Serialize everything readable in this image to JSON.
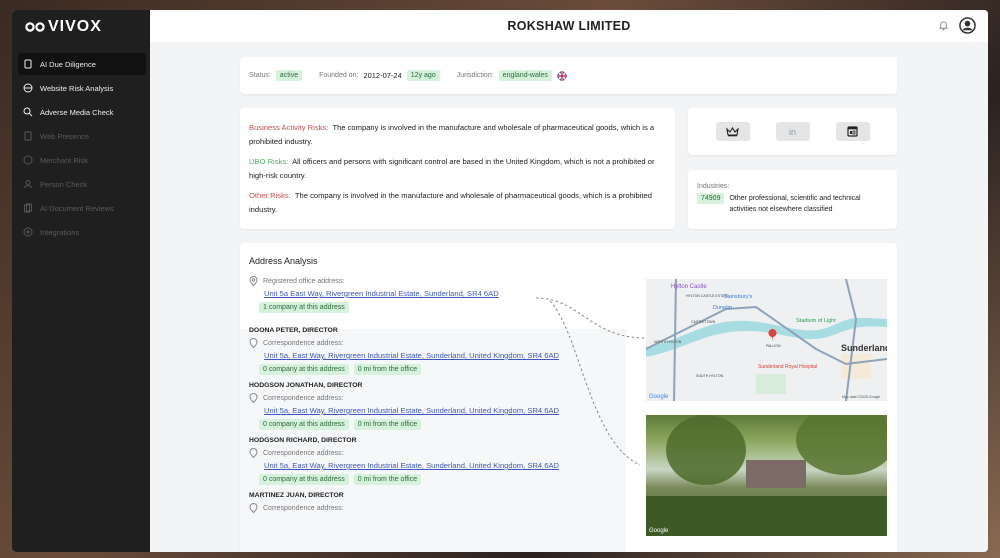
{
  "brand": "VIVOX",
  "sidebar": {
    "items": [
      {
        "label": "AI Due Diligence",
        "icon": "document-icon",
        "state": "active"
      },
      {
        "label": "Website Risk Analysis",
        "icon": "globe-icon",
        "state": "enabled"
      },
      {
        "label": "Adverse Media Check",
        "icon": "search-icon",
        "state": "enabled"
      },
      {
        "label": "Web Presence",
        "icon": "building-icon",
        "state": "disabled"
      },
      {
        "label": "Merchant Risk",
        "icon": "globe-icon",
        "state": "disabled"
      },
      {
        "label": "Person Check",
        "icon": "people-icon",
        "state": "disabled"
      },
      {
        "label": "AI Document Reviews",
        "icon": "files-icon",
        "state": "disabled"
      },
      {
        "label": "Integrations",
        "icon": "plus-circle-icon",
        "state": "disabled"
      }
    ]
  },
  "header": {
    "title": "ROKSHAW LIMITED"
  },
  "status": {
    "status_label": "Status:",
    "status": "active",
    "founded_label": "Founded on:",
    "founded": "2012-07-24",
    "age": "12y ago",
    "jurisdiction_label": "Jurisdiction:",
    "jurisdiction": "england-wales"
  },
  "risks": [
    {
      "label": "Business Activity Risks:",
      "text": "The company is involved in the manufacture and wholesale of pharmaceutical goods, which is a prohibited industry.",
      "color": "#c0504d"
    },
    {
      "label": "UBO Risks:",
      "text": "All officers and persons with significant control are based in the United Kingdom, which is not a prohibited or high-risk country.",
      "color": "#4caf63"
    },
    {
      "label": "Other Risks:",
      "text": "The company is involved in the manufacture and wholesale of pharmaceutical goods, which is a prohibited industry.",
      "color": "#c0504d"
    }
  ],
  "links": {
    "linkedin": "in"
  },
  "industries": {
    "label": "Industries:",
    "code": "74909",
    "description": "Other professional, scientific and technical activities not elsewhere classified"
  },
  "address": {
    "title": "Address Analysis",
    "registered_label": "Registered office address:",
    "registered": "Unit 5a East Way, Rivergreen Industrial Estate, Sunderland, SR4 6AD",
    "registered_tag": "1 company at this address",
    "directors": [
      {
        "name": "DOONA PETER, DIRECTOR",
        "label": "Correspondence address:",
        "address": "Unit 5a, East Way, Rivergreen Industrial Estate, Sunderland, United Kingdom, SR4 6AD",
        "count": "0 company at this address",
        "distance": "0 mi from the office"
      },
      {
        "name": "HODGSON JONATHAN, DIRECTOR",
        "label": "Correspondence address:",
        "address": "Unit 5a, East Way, Rivergreen Industrial Estate, Sunderland, United Kingdom, SR4 6AD",
        "count": "0 company at this address",
        "distance": "0 mi from the office"
      },
      {
        "name": "HODGSON RICHARD, DIRECTOR",
        "label": "Correspondence address:",
        "address": "Unit 5a, East Way, Rivergreen Industrial Estate, Sunderland, United Kingdom, SR4 6AD",
        "count": "0 company at this address",
        "distance": "0 mi from the office"
      },
      {
        "name": "MARTINEZ JUAN, DIRECTOR",
        "label": "Correspondence address:"
      }
    ]
  },
  "map": {
    "labels": [
      "Hylton Castle",
      "HYLTON CASTLE ESTATE",
      "Sainsbury's",
      "Dunelm",
      "CASTLETOWN",
      "Stadium of Light",
      "PALLION",
      "Sunderland",
      "Sunderland Royal Hospital",
      "SOUTH HYLTON",
      "NORTH HYLTON"
    ],
    "attribution": "Map data ©2025 Google",
    "google": "Google"
  },
  "photo": {
    "google": "Google"
  }
}
